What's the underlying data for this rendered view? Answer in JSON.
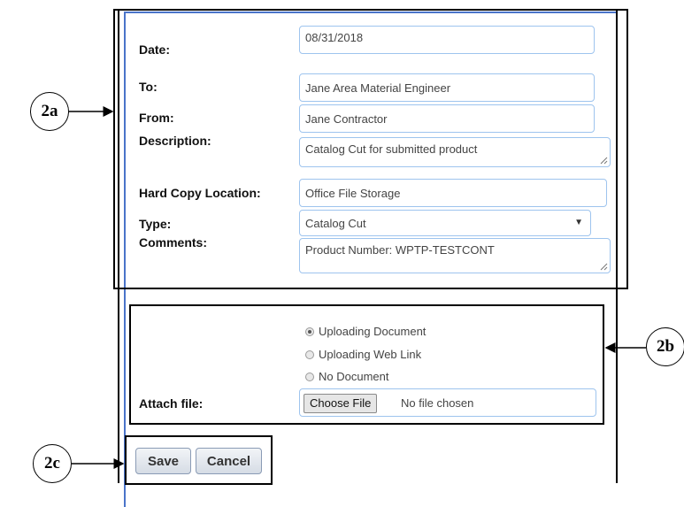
{
  "form": {
    "date": {
      "label": "Date:",
      "value": "08/31/2018"
    },
    "to": {
      "label": "To:",
      "value": "Jane Area Material Engineer"
    },
    "from": {
      "label": "From:",
      "value": "Jane Contractor"
    },
    "description": {
      "label": "Description:",
      "value": "Catalog Cut for submitted product"
    },
    "hard_copy": {
      "label": "Hard Copy Location:",
      "value": "Office File Storage"
    },
    "type": {
      "label": "Type:",
      "value": "Catalog Cut",
      "arrow": "▼"
    },
    "comments": {
      "label": "Comments:",
      "value": "Product Number: WPTP-TESTCONT"
    }
  },
  "attachment": {
    "options": [
      {
        "label": "Uploading Document",
        "selected": true
      },
      {
        "label": "Uploading Web Link",
        "selected": false
      },
      {
        "label": "No Document",
        "selected": false
      }
    ],
    "attach_label": "Attach file:",
    "choose_button": "Choose File",
    "no_file": "No file chosen"
  },
  "actions": {
    "save": "Save",
    "cancel": "Cancel"
  },
  "callouts": {
    "a": "2a",
    "b": "2b",
    "c": "2c"
  }
}
